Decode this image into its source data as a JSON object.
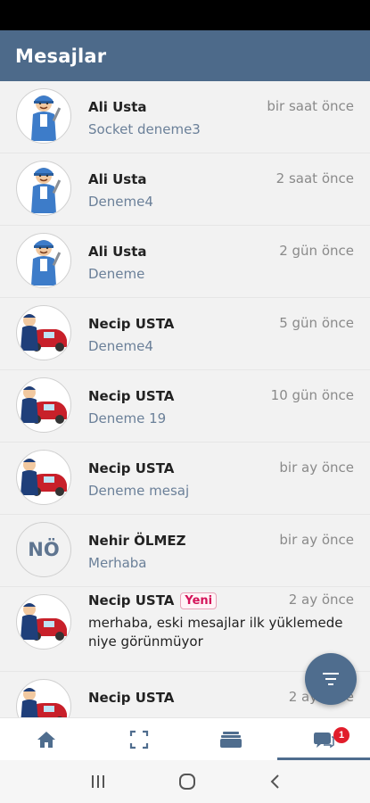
{
  "app_bar": {
    "title": "Mesajlar"
  },
  "conversations": [
    {
      "name": "Ali Usta",
      "time": "bir saat önce",
      "preview": "Socket deneme3",
      "avatar": "mechanic-wrench"
    },
    {
      "name": "Ali Usta",
      "time": "2 saat önce",
      "preview": "Deneme4",
      "avatar": "mechanic-wrench"
    },
    {
      "name": "Ali Usta",
      "time": "2 gün önce",
      "preview": "Deneme",
      "avatar": "mechanic-wrench"
    },
    {
      "name": "Necip USTA",
      "time": "5 gün önce",
      "preview": "Deneme4",
      "avatar": "mechanic-car"
    },
    {
      "name": "Necip USTA",
      "time": "10 gün önce",
      "preview": "Deneme 19",
      "avatar": "mechanic-car"
    },
    {
      "name": "Necip USTA",
      "time": "bir ay önce",
      "preview": "Deneme mesaj",
      "avatar": "mechanic-car"
    },
    {
      "name": "Nehir ÖLMEZ",
      "time": "bir ay önce",
      "preview": "Merhaba",
      "avatar_initials": "NÖ"
    },
    {
      "name": "Necip USTA",
      "badge": "Yeni",
      "time": "2 ay önce",
      "preview": "merhaba, eski mesajlar ilk yüklemede niye görünmüyor",
      "avatar": "mechanic-car"
    },
    {
      "name": "Necip USTA",
      "time": "2 ay önce",
      "preview": "",
      "avatar": "mechanic-car"
    }
  ],
  "fab": {
    "icon": "filter-icon"
  },
  "bottom_nav": {
    "items": [
      {
        "icon": "home-icon"
      },
      {
        "icon": "scan-icon"
      },
      {
        "icon": "cards-icon"
      },
      {
        "icon": "chat-icon",
        "badge": "1",
        "active": true
      }
    ]
  },
  "system_nav": [
    "recent-apps-icon",
    "home-circle-icon",
    "back-icon"
  ],
  "colors": {
    "app_bar": "#4d6a8a",
    "accent": "#4f6d8e",
    "badge": "#e11d2b",
    "preview": "#6b8099"
  }
}
